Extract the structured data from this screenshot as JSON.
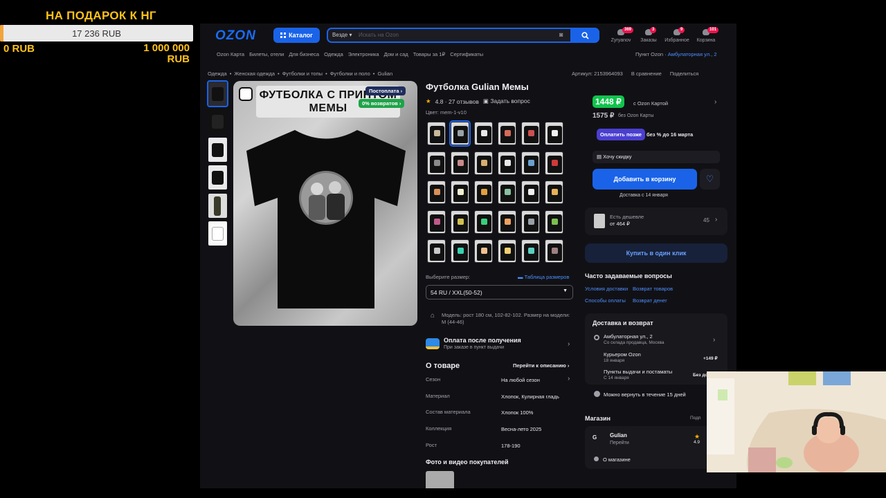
{
  "overlay": {
    "title": "НА ПОДАРОК К НГ",
    "goal_current": "17 236 RUB",
    "goal_progress": 0.017,
    "goal_min": "0 RUB",
    "goal_max": "1 000 000 RUB"
  },
  "header": {
    "logo": "OZON",
    "catalog_label": "Каталог",
    "search_scope": "Везде",
    "search_placeholder": "Искать на Ozon",
    "icons": [
      {
        "label": "Zyryanov",
        "badge": "369",
        "icon": "profile-icon"
      },
      {
        "label": "Заказы",
        "badge": "3",
        "icon": "orders-icon"
      },
      {
        "label": "Избранное",
        "badge": "9",
        "icon": "favorites-icon"
      },
      {
        "label": "Корзина",
        "badge": "101",
        "icon": "cart-icon"
      }
    ],
    "subnav": [
      "Ozon Карта",
      "Билеты, отели",
      "Для бизнеса",
      "Одежда",
      "Электроника",
      "Дом и сад",
      "Товары за 1₽",
      "Сертификаты"
    ],
    "pickup_label": "Пункт Ozon ·",
    "pickup_address": "Амбулаторная ул., 2"
  },
  "breadcrumbs": [
    "Одежда",
    "Женская одежда",
    "Футболки и топы",
    "Футболки и поло",
    "Gulian"
  ],
  "crumb_right": {
    "article": "Артикул: 2153964093",
    "compare": "В сравнение",
    "share": "Поделиться"
  },
  "gallery": {
    "banner_line1": "ФУТБОЛКА С ПРИНТОМ",
    "banner_line2": "МЕМЫ",
    "tag_postpay": "Постоплата",
    "tag_returns": "0% возвратов"
  },
  "product": {
    "title": "Футболка Gulian Мемы",
    "rating": "4.8 · 27 отзывов",
    "ask": "Задать вопрос",
    "color_label": "Цвет: mem-1-v10",
    "size_label": "Выберите размер:",
    "size_table": "Таблица размеров",
    "size_value": "54 RU / XXL(50-52)",
    "model_info": "Модель: рост 180 см, 102-82-102. Размер на модели: M (44-46)",
    "pay_title": "Оплата после получения",
    "pay_sub": "При заказе в пункт выдачи",
    "about_title": "О товаре",
    "about_link": "Перейти к описанию",
    "specs": [
      {
        "k": "Сезон",
        "v": "На любой сезон"
      },
      {
        "k": "Материал",
        "v": "Хлопок, Кулирная гладь"
      },
      {
        "k": "Состав материала",
        "v": "Хлопок 100%"
      },
      {
        "k": "Коллекция",
        "v": "Весна-лето 2025"
      },
      {
        "k": "Рост",
        "v": "178-190"
      }
    ],
    "photos_title": "Фото и видео покупателей"
  },
  "buy": {
    "price_card": "1448 ₽",
    "price_card_note": "с Ozon Картой",
    "price_regular": "1575 ₽",
    "price_regular_note": "без Ozon Карты",
    "pay_later": "Оплатить позже",
    "pay_later_note": "без % до 16 марта",
    "want_discount": "Хочу скидку",
    "add_to_cart": "Добавить в корзину",
    "delivery_note": "Доставка с 14 января",
    "cheaper_title": "Есть дешевле",
    "cheaper_price": "от 464 ₽",
    "cheaper_count": "45",
    "one_click": "Купить в один клик"
  },
  "faq": {
    "title": "Часто задаваемые вопросы",
    "links": [
      "Условия доставки",
      "Возврат товаров",
      "Способы оплаты",
      "Возврат денег"
    ]
  },
  "delivery": {
    "title": "Доставка и возврат",
    "address": "Амбулаторная ул., 2",
    "address_sub": "Со склада продавца, Москва",
    "courier": "Курьером Ozon",
    "courier_date": "18 января",
    "courier_price": "+149 ₽",
    "points": "Пункты выдачи и постаматы",
    "points_date": "С 14 января",
    "points_price": "Без до",
    "return": "Можно вернуть в течение 15 дней"
  },
  "shop": {
    "title": "Магазин",
    "subscribe": "Подп",
    "name": "Gulian",
    "go": "Перейти",
    "rating": "4.9",
    "about": "О магазине"
  }
}
